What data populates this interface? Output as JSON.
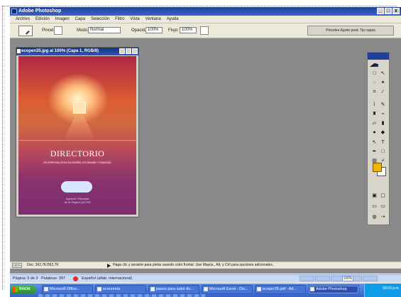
{
  "window": {
    "title": "Adobe Photoshop",
    "buttons": [
      "_",
      "□",
      "x"
    ]
  },
  "menu": [
    "Archivo",
    "Edición",
    "Imagen",
    "Capa",
    "Selección",
    "Filtro",
    "Vista",
    "Ventana",
    "Ayuda"
  ],
  "options": {
    "brush_label": "Pincel:",
    "mode_label": "Modo:",
    "mode_value": "Normal",
    "opacity_label": "Opacid.:",
    "opacity_value": "100%",
    "flow_label": "Flujo:",
    "flow_value": "100%",
    "palette_label": "Pinceles  Ajuste pred.  Tip capas"
  },
  "document": {
    "title": "ecopen35.jpg al 100% (Capa 1, RGB/8)",
    "cover_title": "DIRECTORIO",
    "cover_subtitle": "DE ESPECIALISTAS EN DISEÑO, ECONOMÍA Y FINANZAS",
    "logo_text": "ITFM",
    "agency_line1": "Agencia Tributaria",
    "agency_line2": "de la Región (ACTR)"
  },
  "status": {
    "zoom": "100%",
    "docsize": "Doc: 362,7K/362,7K",
    "hint": "Haga clic y arrastre para pintar usando color frontal. Use Mayús., Alt, y Ctrl para opciones adicionales."
  },
  "word_status": {
    "pages": "Página: 3 de 3",
    "words": "Palabras: 397",
    "language": "Español (alfab. internacional)",
    "zoom": "100%"
  },
  "taskbar": {
    "start": "Inicio",
    "items": [
      "Microsoft Office...",
      "economía",
      "pasos para subir do...",
      "Microsoft Excel - Dis...",
      "ecoper35.pdf - Ad...",
      "Adobe Photoshop"
    ],
    "clock": "08:03 p.m."
  },
  "colors": {
    "foreground": "#f2b400",
    "background": "#ffffff"
  },
  "icons": [
    "brush-tool-icon",
    "move-tool-icon",
    "marquee-tool-icon",
    "lasso-tool-icon",
    "crop-tool-icon",
    "eyedropper-tool-icon",
    "healing-brush-icon",
    "brush-icon",
    "stamp-icon",
    "history-brush-icon",
    "eraser-icon",
    "gradient-icon",
    "pen-icon",
    "type-icon",
    "shape-icon",
    "hand-icon",
    "zoom-icon"
  ]
}
